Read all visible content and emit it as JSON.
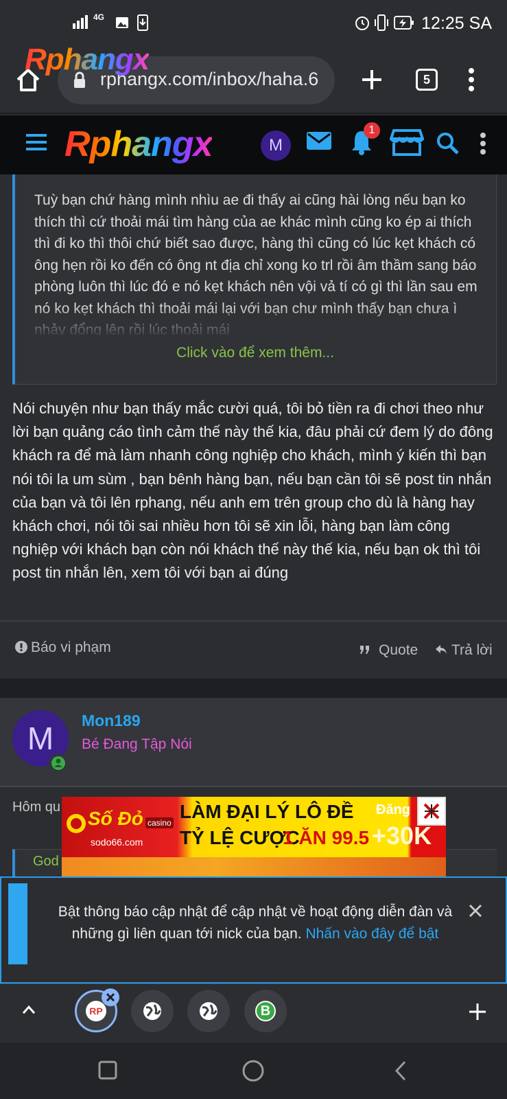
{
  "status_bar": {
    "time": "12:25 SA",
    "network": "4G"
  },
  "browser": {
    "url": "rphangx.com/inbox/haha.6",
    "tab_count": "5",
    "logo_text": "Rphangx"
  },
  "site_header": {
    "logo_text": "Rphangx",
    "avatar_letter": "M",
    "notification_count": "1"
  },
  "quote": {
    "text": "Tuỳ bạn chứ hàng mình nhìu ae đi thấy ai cũng hài lòng nếu bạn ko thích thì cứ thoải mái tìm hàng của ae khác mình cũng ko ép ai thích thì đi ko thì thôi chứ biết sao được, hàng thì cũng có lúc kẹt khách có ông hẹn rồi ko đến có ông nt địa chỉ xong ko trl rồi âm thầm sang báo phòng luôn thì lúc đó e nó kẹt khách nên vội vả tí có gì thì lần sau em nó ko kẹt khách thì thoải mái lại với bạn chư mình thấy bạn chưa ì nhảy đổng lên rồi lúc thoải mái",
    "expand_label": "Click vào để xem thêm..."
  },
  "post": {
    "body": "Nói chuyện như bạn thấy mắc cười quá, tôi bỏ tiền ra đi chơi theo như lời bạn quảng cáo tình cảm thế này thế kia, đâu phải cứ đem lý do đông khách ra để mà làm nhanh công nghiệp cho khách, mình ý kiến thì bạn nói tôi la um sùm , bạn bênh hàng bạn, nếu bạn cần tôi sẽ post tin nhắn của bạn và tôi lên rphang, nếu anh em trên group cho dù là hàng hay khách chơi, nói tôi sai nhiều hơn tôi sẽ xin lỗi, hàng bạn làm công nghiệp với khách bạn còn nói khách thế này thế kia, nếu bạn ok thì tôi post tin nhắn lên, xem tôi với bạn ai đúng",
    "report_label": "Báo vi phạm",
    "quote_label": "Quote",
    "reply_label": "Trả lời"
  },
  "next_post": {
    "avatar_letter": "M",
    "username": "Mon189",
    "user_title": "Bé Đang Tập Nói",
    "preview_start": "Hôm qu",
    "quote_author_start": "God"
  },
  "ad": {
    "brand": "Số Đỏ",
    "brand_sub": "casino",
    "domain": "sodo66.com",
    "line1": "LÀM ĐẠI LÝ LÔ ĐỀ",
    "line2_prefix": "TỶ LỆ CƯỢC",
    "line2_value": "1 ĂN 99.5",
    "badge_top": "Đăng",
    "badge_value": "+30K"
  },
  "notification_prompt": {
    "text": "Bật thông báo cập nhật để cập nhật về hoạt động diễn đàn và những gì liên quan tới nick của bạn.",
    "link": "Nhấn vào đây để bật"
  },
  "bottom_tabs": [
    {
      "label": "RP"
    },
    {
      "label": ""
    },
    {
      "label": ""
    },
    {
      "label": "B"
    }
  ]
}
